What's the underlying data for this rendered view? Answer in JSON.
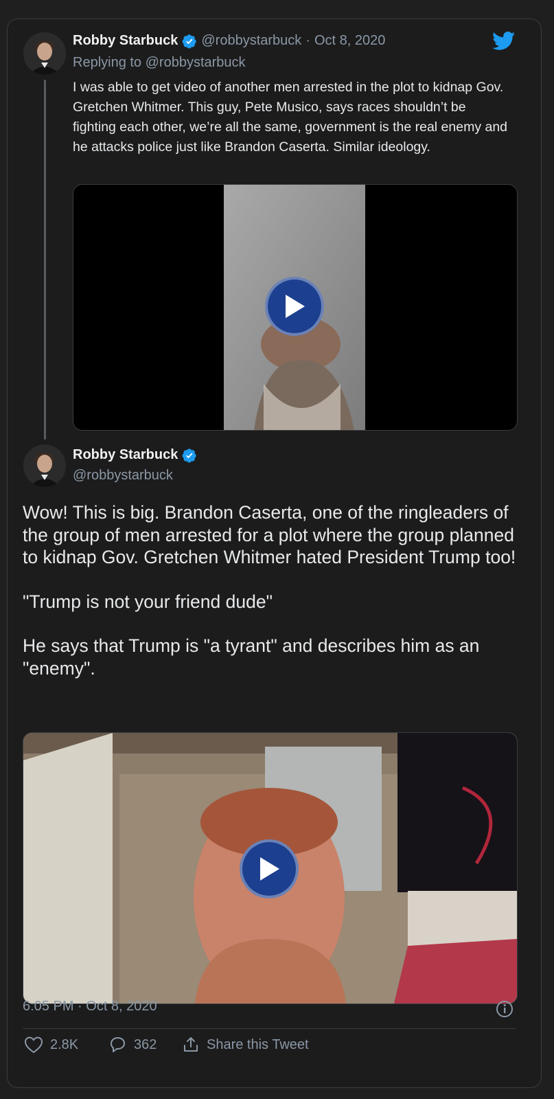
{
  "reply_tweet": {
    "author_name": "Robby Starbuck",
    "handle": "@robbystarbuck",
    "separator": "·",
    "date": "Oct 8, 2020",
    "replying_prefix": "Replying to",
    "replying_to": "@robbystarbuck",
    "text": "I was able to get video of another men arrested in the plot to kidnap Gov. Gretchen Whitmer. This guy, Pete Musico, says races shouldn’t be fighting each other, we’re all the same, government is the real enemy and he attacks police just like Brandon Caserta. Similar ideology."
  },
  "main_tweet": {
    "author_name": "Robby Starbuck",
    "handle": "@robbystarbuck",
    "paragraphs": [
      "Wow! This is big. Brandon Caserta, one of the ringleaders of the group of men arrested for a plot where the group planned to kidnap Gov. Gretchen Whitmer hated President Trump too!",
      "\"Trump is not your friend dude\"",
      "He says that Trump is \"a tyrant\" and describes him as an \"enemy\"."
    ],
    "timestamp": "6:05 PM · Oct 8, 2020",
    "likes": "2.8K",
    "replies": "362",
    "share_label": "Share this Tweet"
  },
  "icons": {
    "brand": "twitter-bird-icon",
    "verified": "verified-badge-icon",
    "play": "play-icon",
    "info": "info-icon",
    "like": "heart-icon",
    "reply": "reply-bubble-icon",
    "share": "share-icon"
  },
  "colors": {
    "background": "#1f1f1f",
    "accent": "#1d9bf0",
    "muted_text": "#8b98a5",
    "play_button": "#1d3f8f"
  }
}
